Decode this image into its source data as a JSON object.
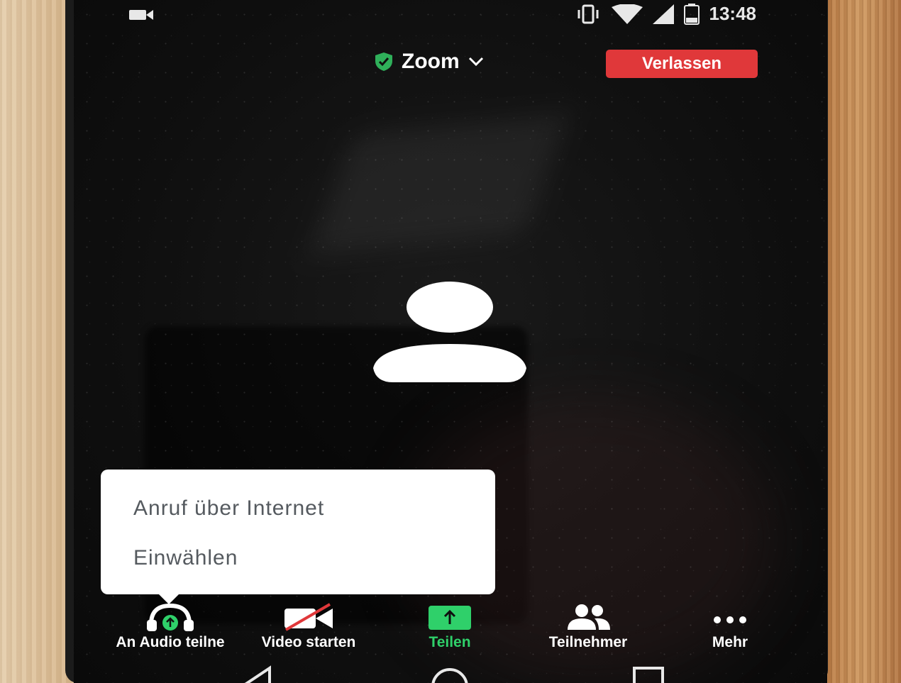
{
  "statusbar": {
    "time": "13:48",
    "icons": [
      "video-recording-icon",
      "vibrate-icon",
      "wifi-icon",
      "cell-signal-icon",
      "battery-icon"
    ]
  },
  "header": {
    "meeting_title": "Zoom",
    "leave_label": "Verlassen",
    "colors": {
      "leave": "#e0383a",
      "shield": "#2fb05a"
    }
  },
  "audio_menu": {
    "items": [
      {
        "label": "Anruf über Internet"
      },
      {
        "label": "Einwählen"
      }
    ]
  },
  "toolbar": {
    "items": [
      {
        "label": "An Audio teilne",
        "icon": "headphones-icon"
      },
      {
        "label": "Video starten",
        "icon": "video-off-icon"
      },
      {
        "label": "Teilen",
        "icon": "share-icon"
      },
      {
        "label": "Teilnehmer",
        "icon": "participants-icon"
      },
      {
        "label": "Mehr",
        "icon": "more-icon"
      }
    ],
    "colors": {
      "active": "#2fd06a"
    }
  },
  "navbar": {
    "buttons": [
      "back-icon",
      "home-icon",
      "recents-icon"
    ]
  }
}
